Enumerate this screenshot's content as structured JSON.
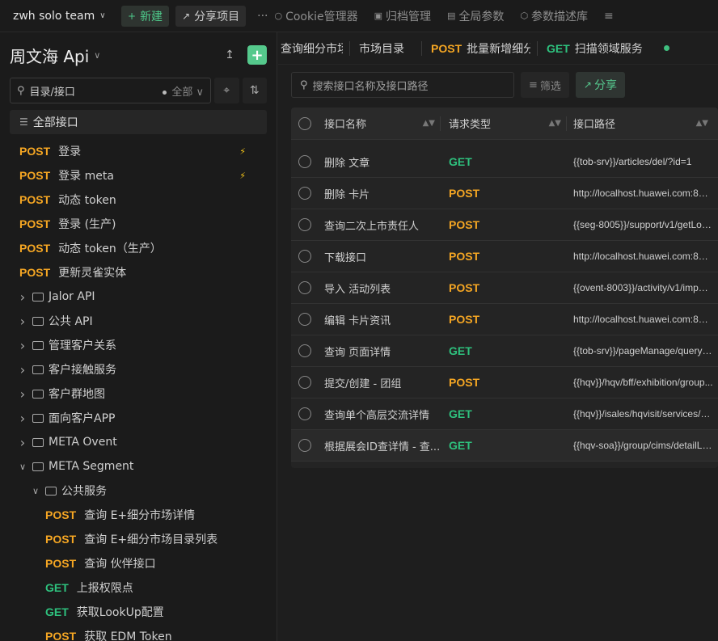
{
  "topbar": {
    "team": "zwh solo team",
    "new_label": "新建",
    "share_label": "分享项目",
    "more": "···",
    "links": [
      "Cookie管理器",
      "归档管理",
      "全局参数",
      "参数描述库"
    ]
  },
  "sidebar": {
    "project_title": "周文海 Api",
    "search_placeholder": "目录/接口",
    "filter_label": "全部",
    "all_label": "全部接口",
    "items": [
      {
        "kind": "api",
        "method": "POST",
        "label": "登录",
        "bolt": true,
        "indent": 0
      },
      {
        "kind": "api",
        "method": "POST",
        "label": "登录 meta",
        "bolt": true,
        "indent": 0
      },
      {
        "kind": "api",
        "method": "POST",
        "label": "动态 token",
        "bolt": false,
        "indent": 0
      },
      {
        "kind": "api",
        "method": "POST",
        "label": "登录 (生产)",
        "bolt": false,
        "indent": 0
      },
      {
        "kind": "api",
        "method": "POST",
        "label": "动态 token（生产）",
        "bolt": false,
        "indent": 0
      },
      {
        "kind": "api",
        "method": "POST",
        "label": "更新灵雀实体",
        "bolt": false,
        "indent": 0
      },
      {
        "kind": "folder",
        "label": "Jalor API",
        "expanded": false,
        "indent": 0
      },
      {
        "kind": "folder",
        "label": "公共 API",
        "expanded": false,
        "indent": 0
      },
      {
        "kind": "folder",
        "label": "管理客户关系",
        "expanded": false,
        "indent": 0
      },
      {
        "kind": "folder",
        "label": "客户接触服务",
        "expanded": false,
        "indent": 0
      },
      {
        "kind": "folder",
        "label": "客户群地图",
        "expanded": false,
        "indent": 0
      },
      {
        "kind": "folder",
        "label": "面向客户APP",
        "expanded": false,
        "indent": 0
      },
      {
        "kind": "folder",
        "label": "META Ovent",
        "expanded": false,
        "indent": 0
      },
      {
        "kind": "folder",
        "label": "META Segment",
        "expanded": true,
        "indent": 0
      },
      {
        "kind": "folder",
        "label": "公共服务",
        "expanded": true,
        "indent": 1
      },
      {
        "kind": "api",
        "method": "POST",
        "label": "查询 E+细分市场详情",
        "bolt": false,
        "indent": 2
      },
      {
        "kind": "api",
        "method": "POST",
        "label": "查询 E+细分市场目录列表",
        "bolt": false,
        "indent": 2
      },
      {
        "kind": "api",
        "method": "POST",
        "label": "查询 伙伴接口",
        "bolt": false,
        "indent": 2
      },
      {
        "kind": "api",
        "method": "GET",
        "label": "上报权限点",
        "bolt": false,
        "indent": 2
      },
      {
        "kind": "api",
        "method": "GET",
        "label": "获取LookUp配置",
        "bolt": false,
        "indent": 2
      },
      {
        "kind": "api",
        "method": "POST",
        "label": "获取 EDM Token",
        "bolt": false,
        "indent": 2
      }
    ]
  },
  "tabs": [
    {
      "method": "",
      "label": "查询细分市场"
    },
    {
      "method": "",
      "label": "市场目录"
    },
    {
      "method": "POST",
      "label": "批量新增细分"
    },
    {
      "method": "GET",
      "label": "扫描领域服务"
    }
  ],
  "toolbar": {
    "search_placeholder": "搜索接口名称及接口路径",
    "filter_label": "筛选",
    "share_label": "分享"
  },
  "table": {
    "headers": {
      "name": "接口名称",
      "type": "请求类型",
      "path": "接口路径"
    },
    "rows": [
      {
        "name": "删除 文章",
        "method": "GET",
        "path": "{{tob-srv}}/articles/del/?id=1"
      },
      {
        "name": "删除 卡片",
        "method": "POST",
        "path": "http://localhost.huawei.com:800..."
      },
      {
        "name": "查询二次上市责任人",
        "method": "POST",
        "path": "{{seg-8005}}/support/v1/getLoca..."
      },
      {
        "name": "下载接口",
        "method": "POST",
        "path": "http://localhost.huawei.com:800..."
      },
      {
        "name": "导入 活动列表",
        "method": "POST",
        "path": "{{ovent-8003}}/activity/v1/import..."
      },
      {
        "name": "编辑 卡片资讯",
        "method": "POST",
        "path": "http://localhost.huawei.com:800..."
      },
      {
        "name": "查询 页面详情",
        "method": "GET",
        "path": "{{tob-srv}}/pageManage/queryBy..."
      },
      {
        "name": "提交/创建 - 团组",
        "method": "POST",
        "path": "{{hqv}}/hqv/bff/exhibition/group..."
      },
      {
        "name": "查询单个高层交流详情",
        "method": "GET",
        "path": "{{hqv}}/isales/hqvisit/services/me..."
      },
      {
        "name": "根据展会ID查详情 - 查...",
        "method": "GET",
        "path": "{{hqv-soa}}/group/cims/detailList..."
      }
    ]
  }
}
